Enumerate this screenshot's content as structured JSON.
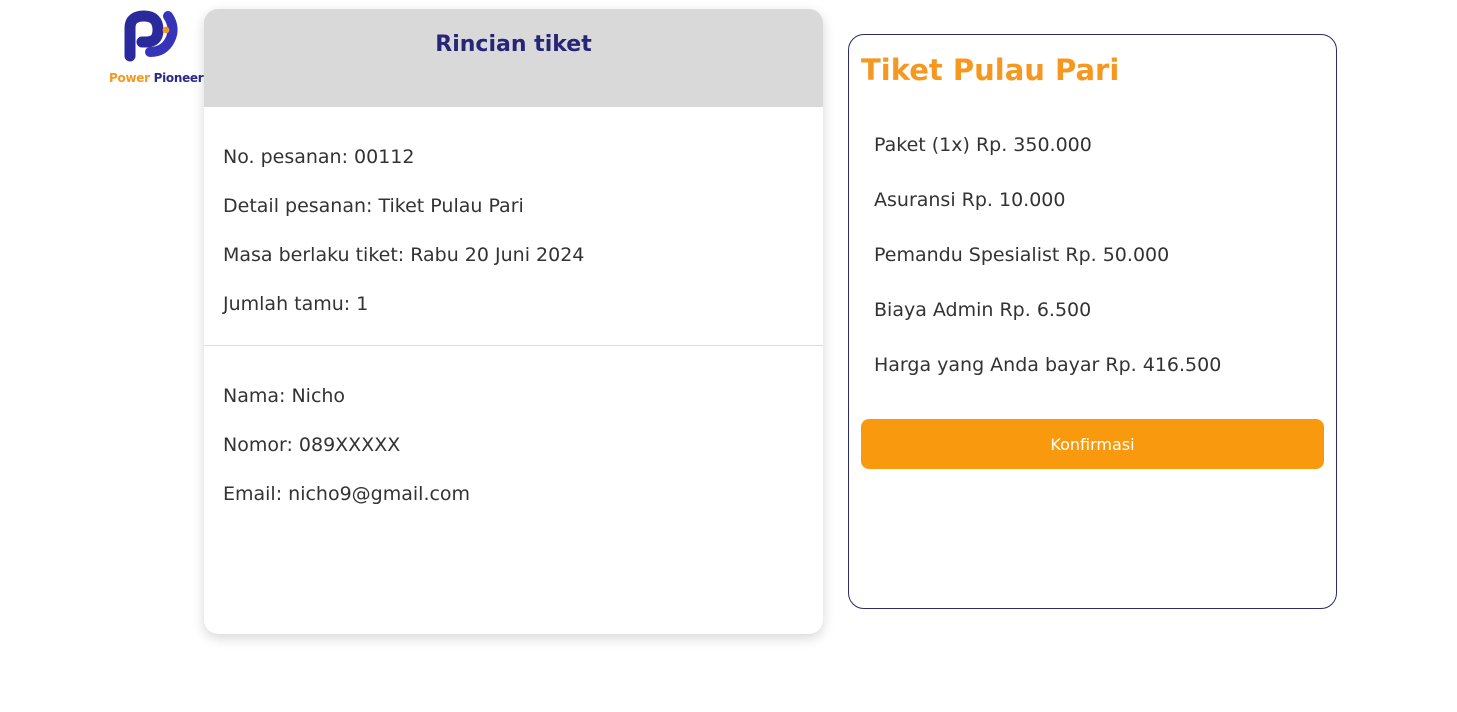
{
  "logo": {
    "word1": "Power",
    "word2": "Pioneers",
    "icon": "power-pioneers-logo-icon",
    "colors": {
      "primary": "#2b2a8c",
      "accent": "#f5981f"
    }
  },
  "ticket_details": {
    "title": "Rincian tiket",
    "order": [
      {
        "label": "No. pesanan: 00112"
      },
      {
        "label": "Detail pesanan: Tiket Pulau Pari"
      },
      {
        "label": "Masa berlaku tiket: Rabu 20 Juni 2024"
      },
      {
        "label": "Jumlah tamu: 1"
      }
    ],
    "guest": [
      {
        "label": "Nama: Nicho"
      },
      {
        "label": "Nomor: 089XXXXX"
      },
      {
        "label": "Email: nicho9@gmail.com"
      }
    ]
  },
  "pricing": {
    "title": "Tiket Pulau Pari",
    "lines": [
      {
        "label": "Paket (1x) Rp. 350.000"
      },
      {
        "label": "Asuransi Rp. 10.000"
      },
      {
        "label": "Pemandu Spesialist Rp. 50.000"
      },
      {
        "label": "Biaya Admin Rp. 6.500"
      },
      {
        "label": "Harga yang Anda bayar Rp. 416.500"
      }
    ],
    "confirm_label": "Konfirmasi",
    "colors": {
      "accent": "#f99a0e",
      "title": "#f5981f",
      "border": "#2b2a6a"
    }
  }
}
